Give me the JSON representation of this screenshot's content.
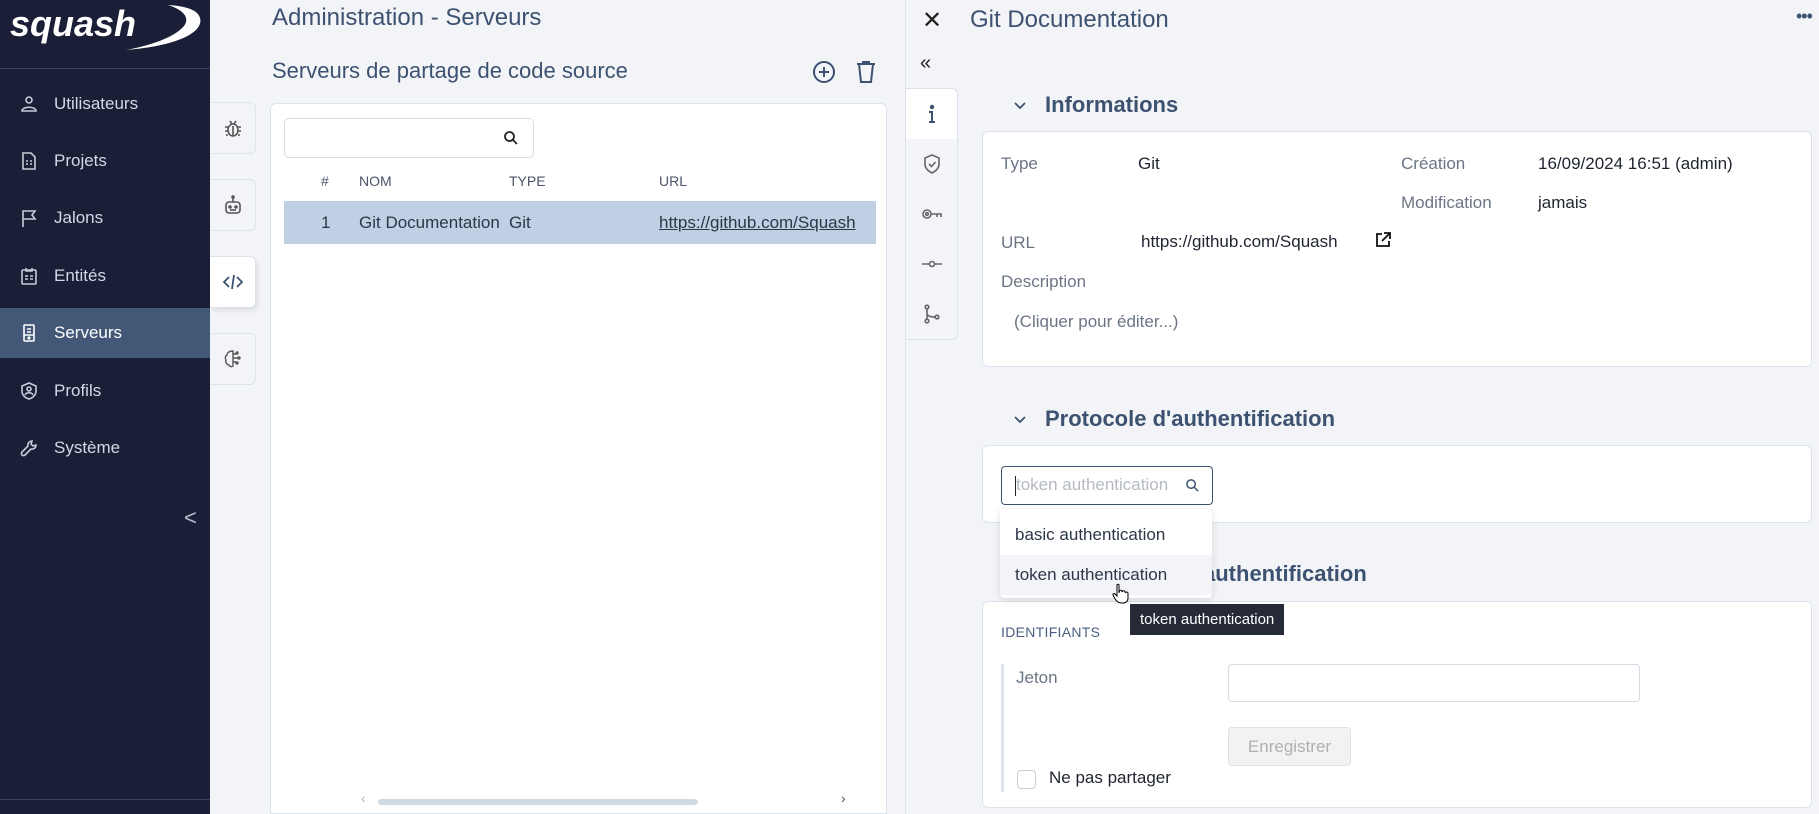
{
  "app": {
    "logo_text": "squash"
  },
  "sidebar": {
    "items": [
      {
        "label": "Utilisateurs",
        "icon": "user-icon"
      },
      {
        "label": "Projets",
        "icon": "project-document-icon"
      },
      {
        "label": "Jalons",
        "icon": "flag-icon"
      },
      {
        "label": "Entités",
        "icon": "clipboard-icon"
      },
      {
        "label": "Serveurs",
        "icon": "server-icon",
        "active": true
      },
      {
        "label": "Profils",
        "icon": "shield-user-icon"
      },
      {
        "label": "Système",
        "icon": "wrench-icon"
      }
    ],
    "collapse_glyph": "<"
  },
  "main": {
    "page_title": "Administration - Serveurs",
    "section_title": "Serveurs de partage de code source",
    "side_tabs": [
      {
        "name": "bugtracker-servers",
        "icon": "bug-icon"
      },
      {
        "name": "automation-servers",
        "icon": "robot-icon"
      },
      {
        "name": "scm-servers",
        "icon": "code-icon",
        "active": true
      },
      {
        "name": "ai-servers",
        "icon": "brain-icon"
      }
    ],
    "search": {
      "value": "",
      "placeholder": ""
    },
    "table": {
      "columns": [
        "#",
        "NOM",
        "TYPE",
        "URL"
      ],
      "rows": [
        {
          "num": "1",
          "nom": "Git Documentation",
          "type": "Git",
          "url": "https://github.com/Squash",
          "selected": true
        }
      ]
    },
    "scroll_left": "‹",
    "scroll_right": "›"
  },
  "detail": {
    "close_glyph": "✕",
    "title": "Git Documentation",
    "more_glyph": "•••",
    "collapse_glyph": "«",
    "tabs": [
      {
        "icon": "info-icon",
        "active": true
      },
      {
        "icon": "shield-check-icon"
      },
      {
        "icon": "key-icon"
      },
      {
        "icon": "commit-icon"
      },
      {
        "icon": "branch-icon"
      }
    ],
    "info_section": {
      "title": "Informations",
      "type_label": "Type",
      "type_value": "Git",
      "creation_label": "Création",
      "creation_value": "16/09/2024 16:51 (admin)",
      "modification_label": "Modification",
      "modification_value": "jamais",
      "url_label": "URL",
      "url_value": "https://github.com/Squash",
      "description_label": "Description",
      "description_placeholder": "(Cliquer pour éditer...)"
    },
    "protocol_section": {
      "title": "Protocole d'authentification",
      "select_placeholder": "token authentication",
      "options": [
        "basic authentication",
        "token authentication"
      ],
      "hovered_option": "token authentication",
      "tooltip": "token authentication"
    },
    "credentials_section": {
      "title": "Informations d'authentification",
      "group_label": "IDENTIFIANTS",
      "token_label": "Jeton",
      "token_value": "",
      "save_label": "Enregistrer",
      "no_share_label": "Ne pas partager",
      "no_share_checked": false
    }
  }
}
